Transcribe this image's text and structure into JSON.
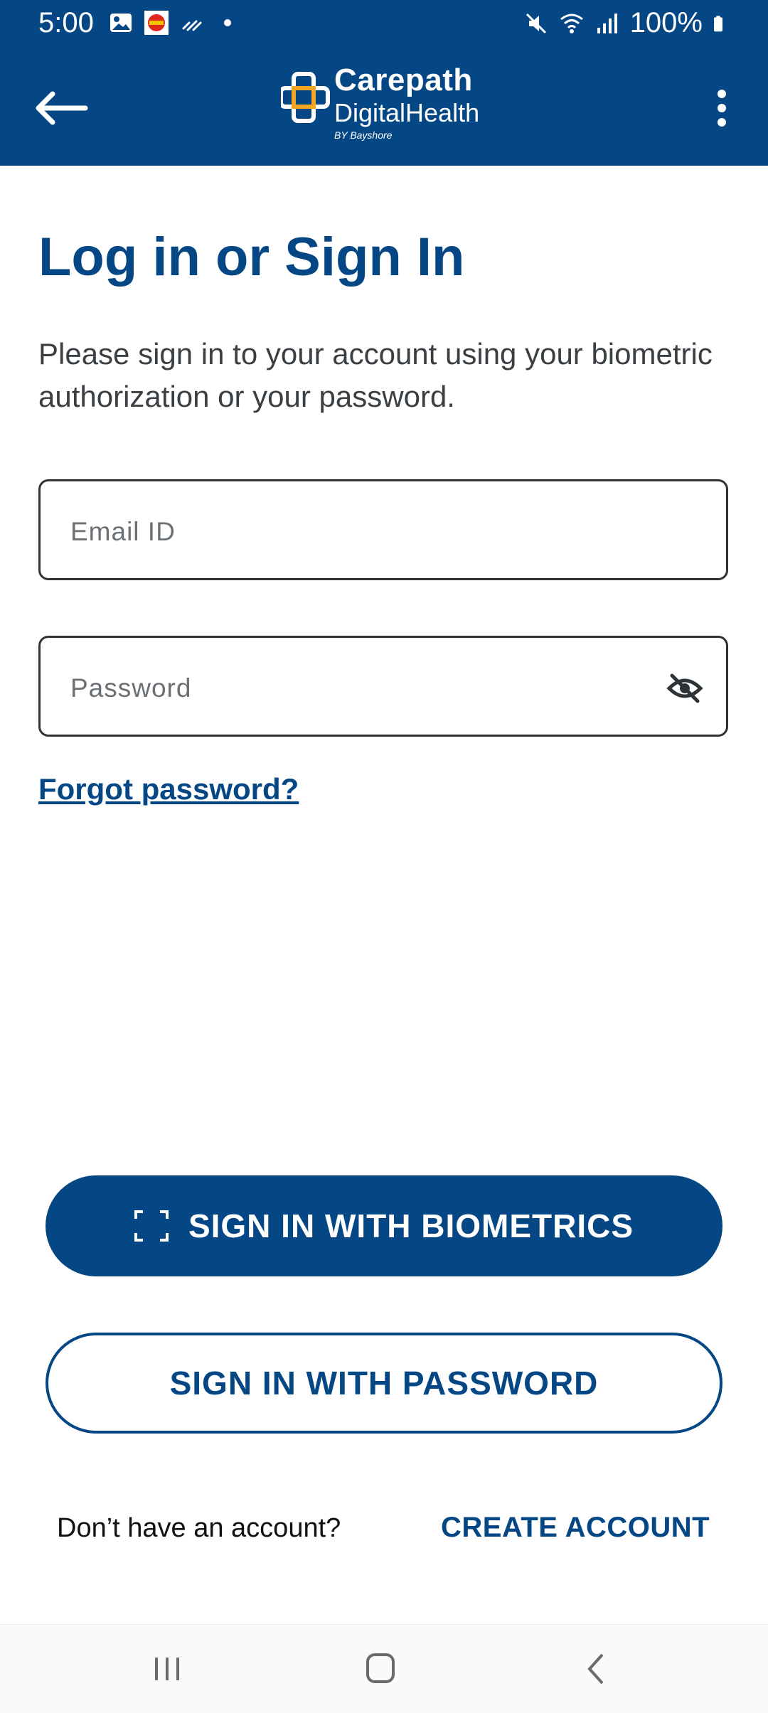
{
  "status_bar": {
    "time": "5:00",
    "battery": "100%",
    "left_icons": [
      "image-icon",
      "app-notification-icon",
      "cast-icon",
      "dot-icon"
    ],
    "right_icons": [
      "mute-icon",
      "wifi-icon",
      "signal-icon",
      "battery-icon"
    ]
  },
  "app_bar": {
    "logo_title": "Carepath",
    "logo_subtitle": "DigitalHealth",
    "logo_by": "BY Bayshore",
    "brand_color": "#054785",
    "accent_color": "#F5A623"
  },
  "page": {
    "title": "Log in or Sign In",
    "subtitle": "Please sign in to your account using your biometric authorization or your password."
  },
  "form": {
    "email_placeholder": "Email ID",
    "password_placeholder": "Password",
    "forgot_label": "Forgot password?"
  },
  "actions": {
    "biometrics_label": "SIGN IN WITH BIOMETRICS",
    "password_label": "SIGN IN WITH PASSWORD"
  },
  "footer": {
    "no_account_text": "Don’t have an account?",
    "create_account_label": "CREATE ACCOUNT"
  },
  "nav_bar": {
    "buttons": [
      "recent-apps-icon",
      "home-icon",
      "back-icon"
    ]
  }
}
